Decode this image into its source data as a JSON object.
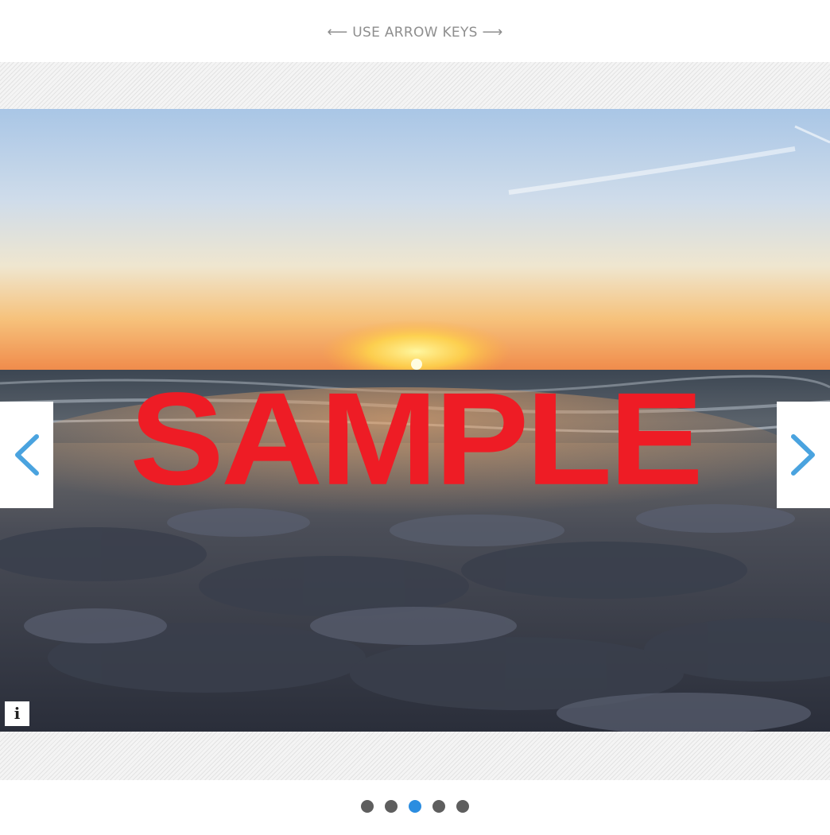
{
  "hint": {
    "text": "USE ARROW KEYS",
    "left_arrow": "⟵",
    "right_arrow": "⟶"
  },
  "slide": {
    "watermark": "SAMPLE",
    "info_label": "i"
  },
  "navigation": {
    "prev_icon": "chevron-left-icon",
    "next_icon": "chevron-right-icon",
    "accent_color": "#4aa3df"
  },
  "pagination": {
    "total": 5,
    "active_index": 2,
    "active_color": "#2b8de0",
    "inactive_color": "#5e5e5e"
  }
}
